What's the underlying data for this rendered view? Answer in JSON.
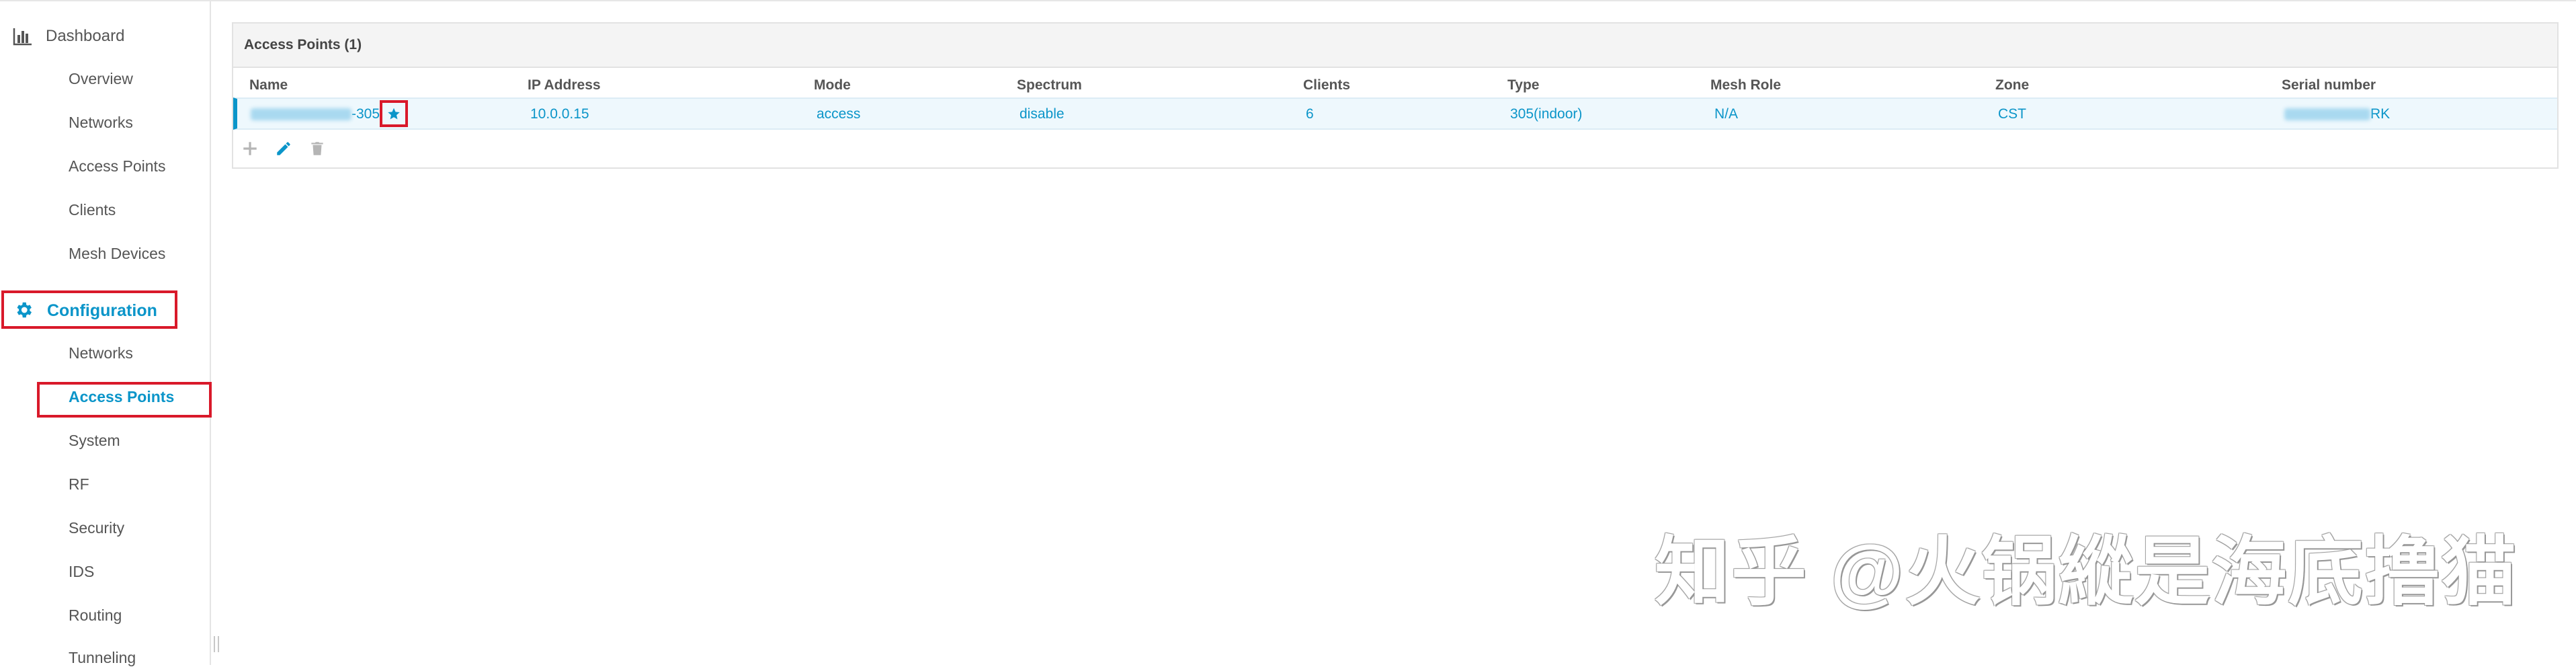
{
  "sidebar": {
    "dashboard": {
      "label": "Dashboard",
      "items": [
        "Overview",
        "Networks",
        "Access Points",
        "Clients",
        "Mesh Devices"
      ]
    },
    "configuration": {
      "label": "Configuration",
      "items": [
        "Networks",
        "Access Points",
        "System",
        "RF",
        "Security",
        "IDS",
        "Routing",
        "Tunneling"
      ],
      "active_item": "Access Points"
    }
  },
  "panel": {
    "title": "Access Points (1)",
    "columns": [
      "Name",
      "IP Address",
      "Mode",
      "Spectrum",
      "Clients",
      "Type",
      "Mesh Role",
      "Zone",
      "Serial number"
    ],
    "rows": [
      {
        "name_suffix": "-305",
        "ip": "10.0.0.15",
        "mode": "access",
        "spectrum": "disable",
        "clients": "6",
        "type": "305(indoor)",
        "mesh_role": "N/A",
        "zone": "CST",
        "serial_suffix": "RK"
      }
    ]
  },
  "toolbar": {
    "icons": [
      "plus-icon",
      "pencil-icon",
      "trash-icon"
    ]
  },
  "watermark": "知乎 @火锅縱是海底撸猫",
  "colors": {
    "accent": "#0b95c9",
    "highlight": "#d9192a",
    "row_bg": "#eef8fd"
  }
}
